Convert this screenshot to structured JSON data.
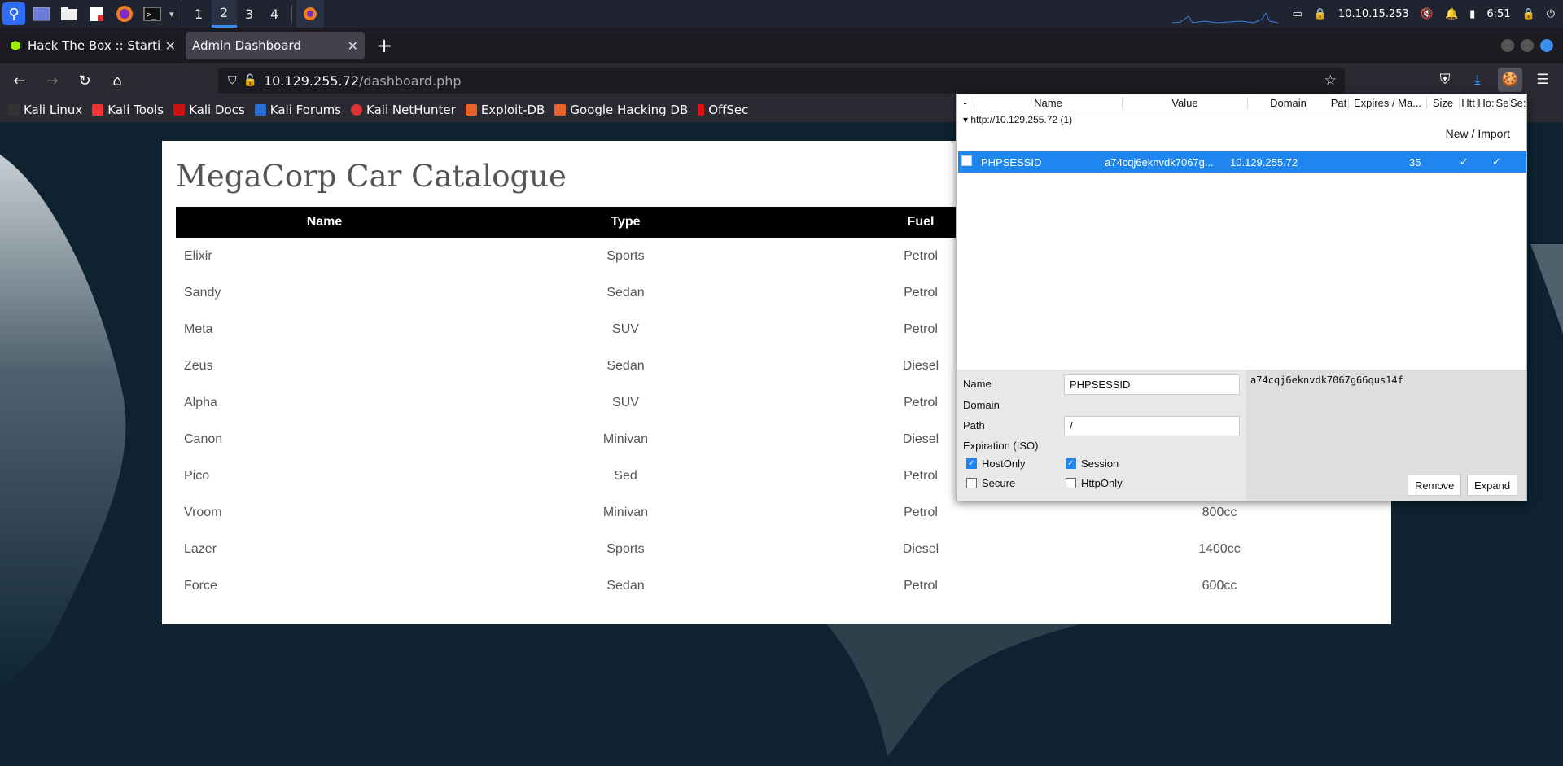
{
  "os_panel": {
    "workspaces": [
      "1",
      "2",
      "3",
      "4"
    ],
    "active_workspace": "2",
    "ip_address": "10.10.15.253",
    "clock": "6:51"
  },
  "browser": {
    "tabs": [
      {
        "title": "Hack The Box :: Starting P",
        "active": false
      },
      {
        "title": "Admin Dashboard",
        "active": true
      }
    ],
    "url_host": "10.129.255.72",
    "url_path": "/dashboard.php",
    "bookmarks": [
      "Kali Linux",
      "Kali Tools",
      "Kali Docs",
      "Kali Forums",
      "Kali NetHunter",
      "Exploit-DB",
      "Google Hacking DB",
      "OffSec"
    ]
  },
  "page": {
    "title": "MegaCorp Car Catalogue",
    "table_headers": [
      "Name",
      "Type",
      "Fuel",
      ""
    ],
    "rows": [
      {
        "name": "Elixir",
        "type": "Sports",
        "fuel": "Petrol",
        "engine": ""
      },
      {
        "name": "Sandy",
        "type": "Sedan",
        "fuel": "Petrol",
        "engine": ""
      },
      {
        "name": "Meta",
        "type": "SUV",
        "fuel": "Petrol",
        "engine": ""
      },
      {
        "name": "Zeus",
        "type": "Sedan",
        "fuel": "Diesel",
        "engine": ""
      },
      {
        "name": "Alpha",
        "type": "SUV",
        "fuel": "Petrol",
        "engine": ""
      },
      {
        "name": "Canon",
        "type": "Minivan",
        "fuel": "Diesel",
        "engine": ""
      },
      {
        "name": "Pico",
        "type": "Sed",
        "fuel": "Petrol",
        "engine": ""
      },
      {
        "name": "Vroom",
        "type": "Minivan",
        "fuel": "Petrol",
        "engine": "800cc"
      },
      {
        "name": "Lazer",
        "type": "Sports",
        "fuel": "Diesel",
        "engine": "1400cc"
      },
      {
        "name": "Force",
        "type": "Sedan",
        "fuel": "Petrol",
        "engine": "600cc"
      }
    ]
  },
  "cookie_editor": {
    "columns": [
      "-",
      "Name",
      "Value",
      "Domain",
      "Pat",
      "Expires / Ma...",
      "Size",
      "Htt",
      "Ho:",
      "Se",
      "Se:"
    ],
    "group_label": "▾ http://10.129.255.72 (1)",
    "new_import_label": "New / Import",
    "row": {
      "name": "PHPSESSID",
      "value": "a74cqj6eknvdk7067g...",
      "domain": "10.129.255.72",
      "size": "35",
      "hostonly_mark": "✓",
      "session_mark": "✓"
    },
    "detail": {
      "name_label": "Name",
      "name_value": "PHPSESSID",
      "domain_label": "Domain",
      "path_label": "Path",
      "path_value": "/",
      "expiration_label": "Expiration (ISO)",
      "hostonly_label": "HostOnly",
      "session_label": "Session",
      "secure_label": "Secure",
      "httponly_label": "HttpOnly",
      "full_value": "a74cqj6eknvdk7067g66qus14f",
      "remove_label": "Remove",
      "expand_label": "Expand"
    }
  }
}
